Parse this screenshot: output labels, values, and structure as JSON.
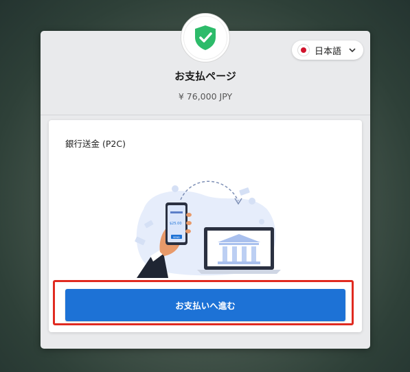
{
  "header": {
    "title": "お支払ページ",
    "amount": "¥ 76,000 JPY"
  },
  "language": {
    "selected": "日本語",
    "flag_icon": "japan-flag-icon"
  },
  "payment_method": {
    "label": "銀行送金 (P2C)"
  },
  "phone_screen": {
    "amount_text": "$25.00",
    "send_label": "SEND"
  },
  "actions": {
    "proceed_label": "お支払いへ進む"
  },
  "colors": {
    "accent": "#1d72d6",
    "shield": "#2dbb6a",
    "highlight": "#e02a20"
  }
}
